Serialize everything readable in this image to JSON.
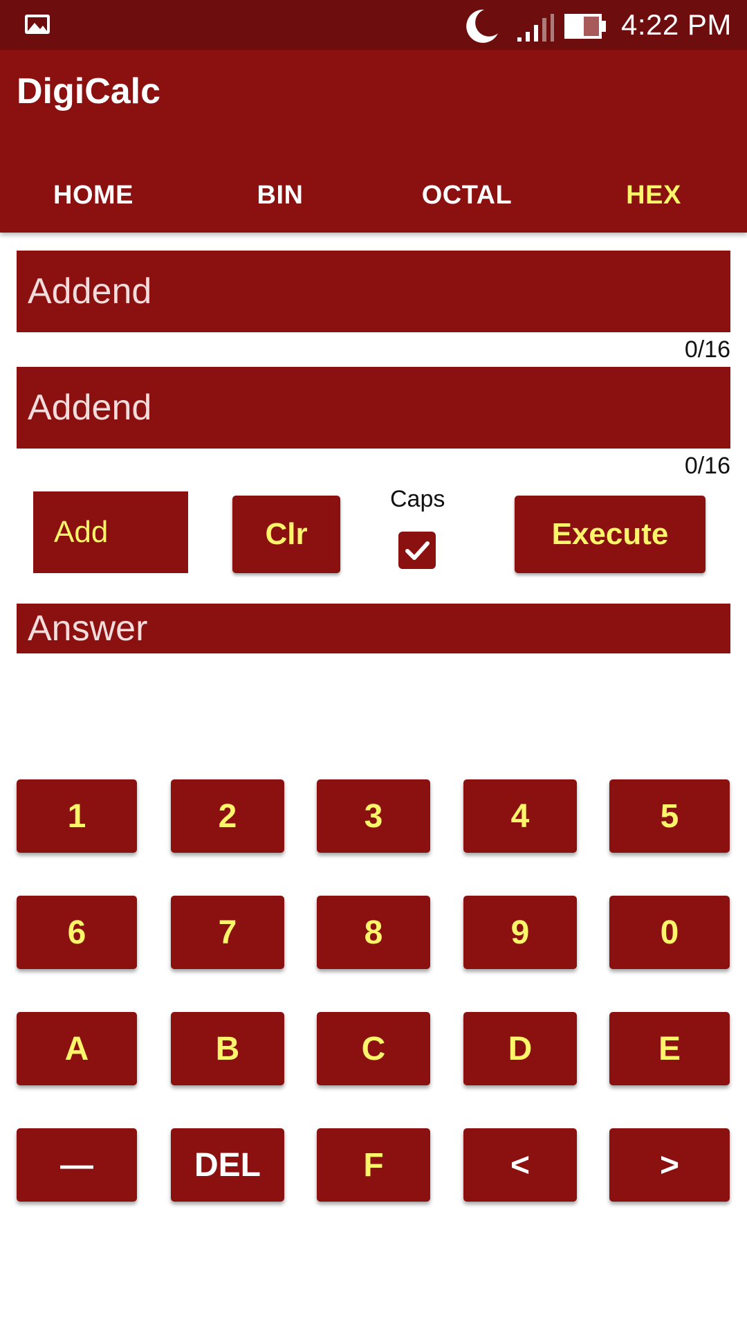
{
  "status_bar": {
    "time": "4:22 PM",
    "icons": [
      "gallery-icon",
      "moon-icon",
      "signal-icon",
      "battery-icon"
    ]
  },
  "app": {
    "title": "DigiCalc",
    "colors": {
      "primary": "#8b1010",
      "status": "#6e0d0d",
      "accent": "#fff56b"
    }
  },
  "tabs": [
    {
      "label": "HOME",
      "active": false
    },
    {
      "label": "BIN",
      "active": false
    },
    {
      "label": "OCTAL",
      "active": false
    },
    {
      "label": "HEX",
      "active": true
    }
  ],
  "inputs": [
    {
      "placeholder": "Addend",
      "value": "",
      "counter": "0/16"
    },
    {
      "placeholder": "Addend",
      "value": "",
      "counter": "0/16"
    }
  ],
  "controls": {
    "operation": "Add",
    "clear_label": "Clr",
    "caps_label": "Caps",
    "caps_checked": true,
    "execute_label": "Execute"
  },
  "answer": {
    "placeholder": "Answer"
  },
  "keypad": [
    [
      "1",
      "2",
      "3",
      "4",
      "5"
    ],
    [
      "6",
      "7",
      "8",
      "9",
      "0"
    ],
    [
      "A",
      "B",
      "C",
      "D",
      "E"
    ],
    [
      "—",
      "DEL",
      "F",
      "<",
      ">"
    ]
  ]
}
